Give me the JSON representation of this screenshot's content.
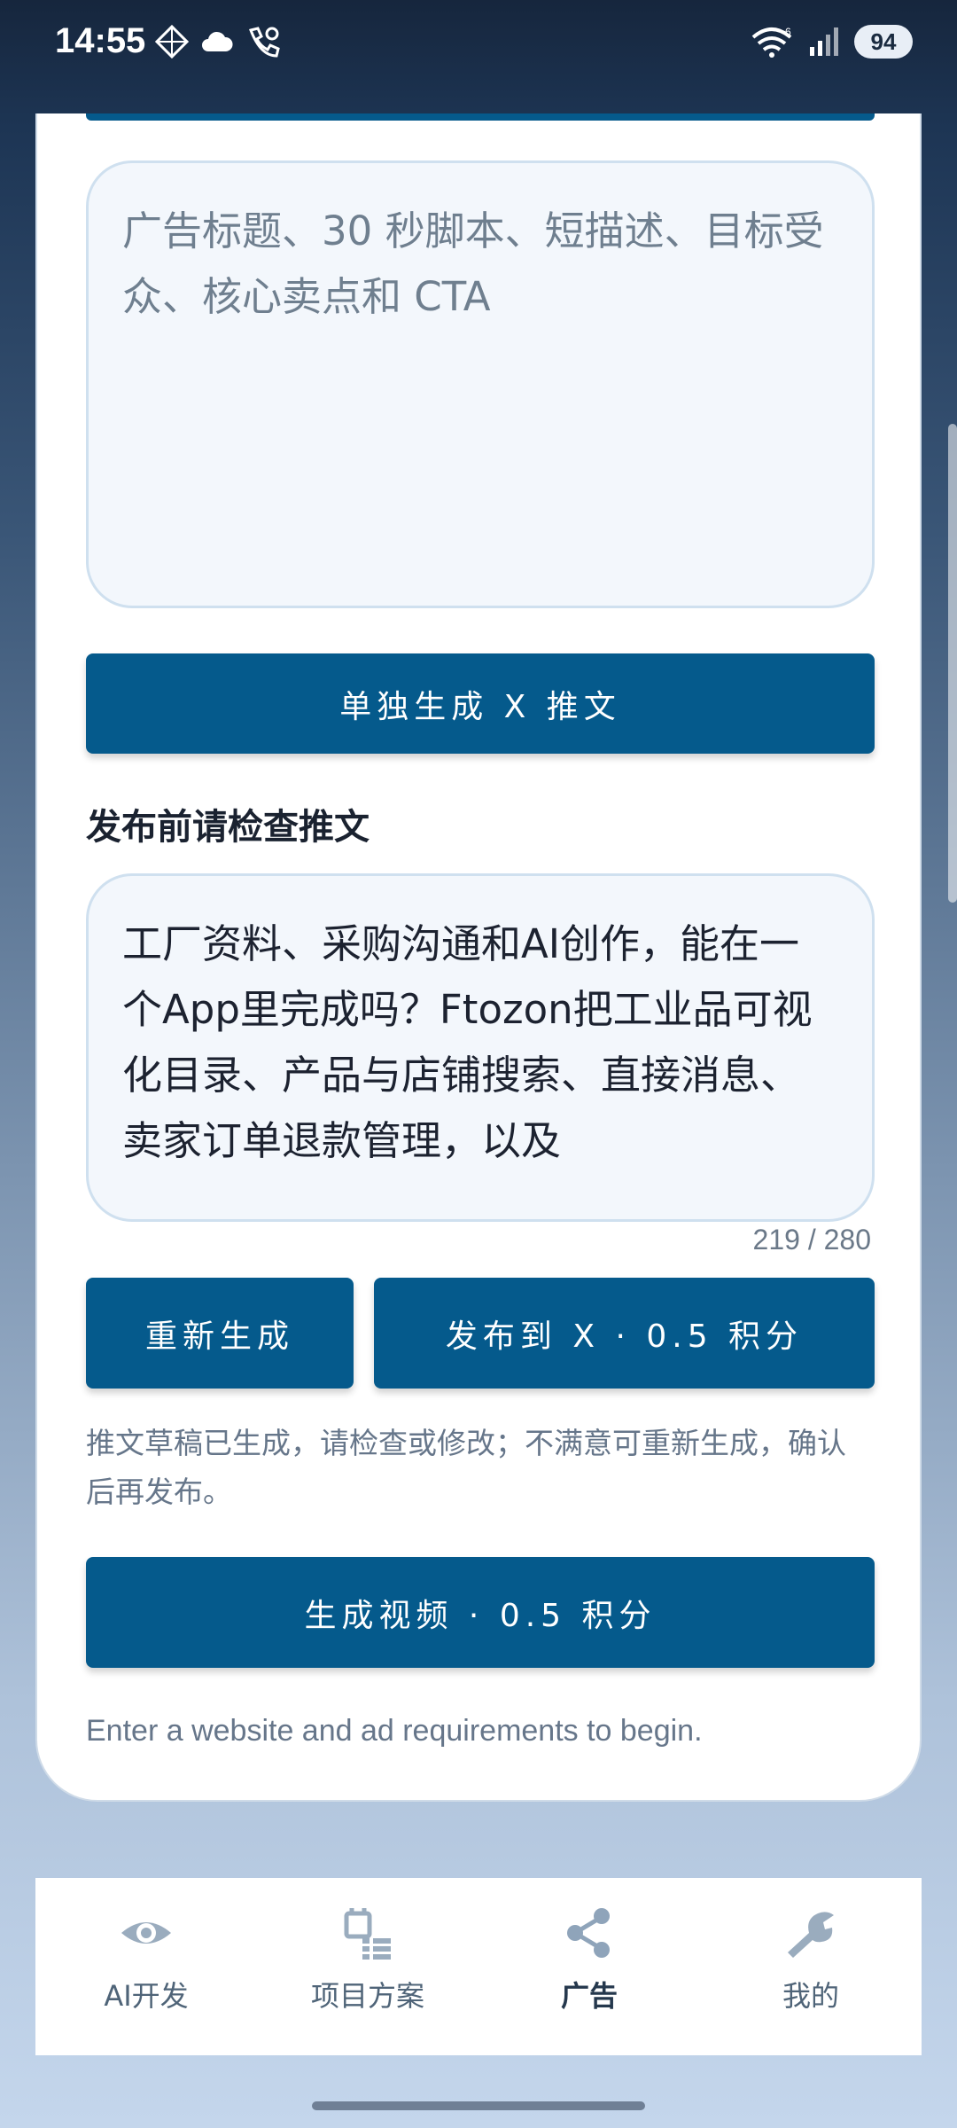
{
  "status_bar": {
    "time": "14:55",
    "battery": "94",
    "wifi_label": "6"
  },
  "ad_requirements": {
    "placeholder": "广告标题、30 秒脚本、短描述、目标受众、核心卖点和 CTA"
  },
  "buttons": {
    "generate_x": "单独生成 X 推文",
    "regenerate": "重新生成",
    "publish": "发布到 X · 0.5 积分",
    "generate_video": "生成视频 · 0.5 积分"
  },
  "review": {
    "title": "发布前请检查推文",
    "draft_text": "工厂资料、采购沟通和AI创作，能在一个App里完成吗？Ftozon把工业品可视化目录、产品与店铺搜索、直接消息、卖家订单退款管理，以及",
    "char_count": "219 / 280",
    "hint": "推文草稿已生成，请检查或修改；不满意可重新生成，确认后再发布。"
  },
  "begin_hint": "Enter a website and ad requirements to begin.",
  "nav": {
    "items": [
      {
        "label": "AI开发",
        "icon": "eye-icon"
      },
      {
        "label": "项目方案",
        "icon": "plan-icon"
      },
      {
        "label": "广告",
        "icon": "share-icon",
        "active": true
      },
      {
        "label": "我的",
        "icon": "wrench-icon"
      }
    ]
  },
  "colors": {
    "primary": "#055a8c",
    "textarea_bg": "#f3f7fc"
  }
}
